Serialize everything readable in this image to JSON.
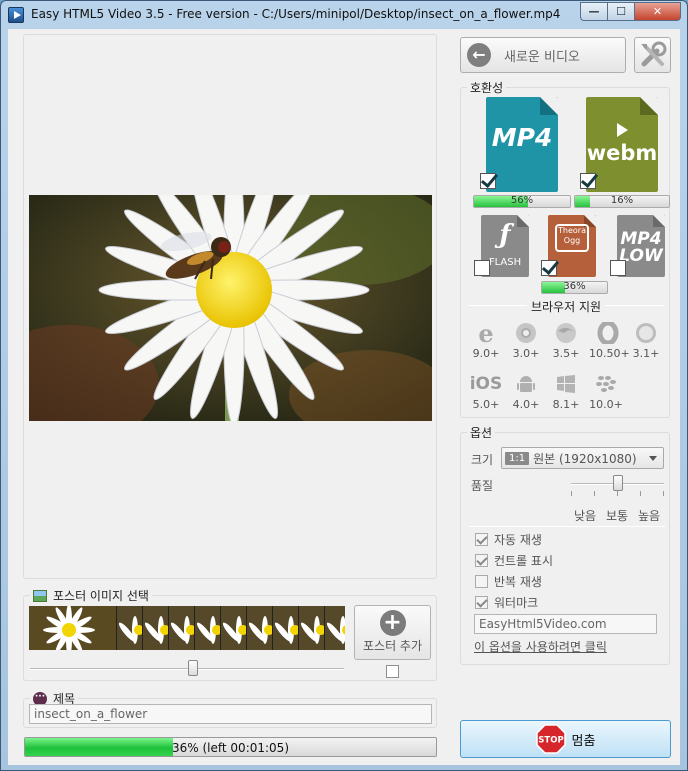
{
  "window": {
    "title": "Easy HTML5 Video 3.5  - Free version - C:/Users/minipol/Desktop/insect_on_a_flower.mp4",
    "controls": {
      "minimize": "—",
      "maximize": "☐",
      "close": "✕"
    }
  },
  "toolbar": {
    "new_video_label": "새로운 비디오"
  },
  "poster": {
    "group_title": "포스터 이미지 선택",
    "add_label": "포스터 추가",
    "add_checked": false,
    "slider_position": 0.52
  },
  "video_title": {
    "group_title": "제목",
    "value": "insect_on_a_flower"
  },
  "progress": {
    "value": 0.36,
    "label": "36% (left 00:01:05)"
  },
  "compatibility": {
    "group_title": "호환성",
    "formats": [
      {
        "name": "MP4",
        "checked": true,
        "progress": 0.56,
        "label": "56%"
      },
      {
        "name": "webm",
        "checked": true,
        "progress": 0.16,
        "label": "16%"
      },
      {
        "name": "FLASH",
        "checked": false
      },
      {
        "name": "Theora Ogg",
        "checked": true,
        "progress": 0.36,
        "label": "36%"
      },
      {
        "name": "MP4 LOW",
        "checked": false
      }
    ],
    "browser_title": "브라우저 지원",
    "browsers": [
      {
        "icon": "ie-icon",
        "version": "9.0+"
      },
      {
        "icon": "chrome-icon",
        "version": "3.0+"
      },
      {
        "icon": "firefox-icon",
        "version": "3.5+"
      },
      {
        "icon": "opera-icon",
        "version": "10.50+"
      },
      {
        "icon": "safari-icon",
        "version": "3.1+"
      },
      {
        "icon": "ios-icon",
        "label": "iOS",
        "version": "5.0+"
      },
      {
        "icon": "android-icon",
        "version": "4.0+"
      },
      {
        "icon": "windows-icon",
        "version": "8.1+"
      },
      {
        "icon": "blackberry-icon",
        "version": "10.0+"
      }
    ]
  },
  "options": {
    "group_title": "옵션",
    "size_label": "크기",
    "size_badge": "1:1",
    "size_value": "원본 (1920x1080)",
    "quality_label": "품질",
    "quality_low": "낮음",
    "quality_mid": "보통",
    "quality_high": "높음",
    "quality_level": 0.5,
    "autoplay": {
      "label": "자동 재생",
      "checked": true
    },
    "controls": {
      "label": "컨트롤 표시",
      "checked": true
    },
    "loop": {
      "label": "반복 재생",
      "checked": false
    },
    "watermark": {
      "label": "워터마크",
      "checked": true
    },
    "watermark_text": "EasyHtml5Video.com",
    "unlock_link": "이 옵션을 사용하려면 클릭"
  },
  "stop_button": {
    "sign": "STOP",
    "label": "멈춤"
  },
  "colors": {
    "mp4": "#1f94a6",
    "webm": "#7d8f2e",
    "progress_green": "#26c23e",
    "stop_red": "#d6262b"
  }
}
